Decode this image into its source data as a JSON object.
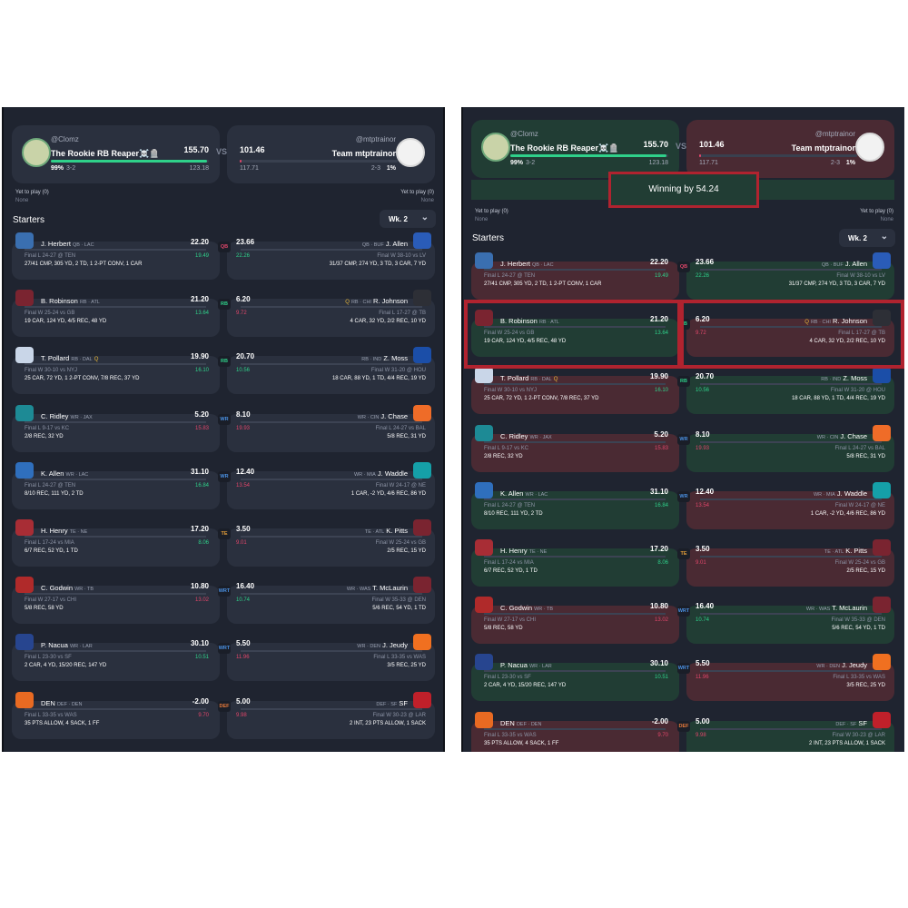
{
  "colors": {
    "win": "#213d34",
    "lose": "#4a2a33",
    "green": "#2fd18a",
    "red": "#e0466a",
    "highlight": "#b0232f"
  },
  "matchup": {
    "home": {
      "handle": "@Clomz",
      "name": "The Rookie RB Reaper☠️🪦",
      "score": "155.70",
      "projected": "123.18",
      "record": "3-2",
      "win_pct": "99%"
    },
    "away": {
      "handle": "@mtptrainor",
      "name": "Team mtptrainor",
      "score": "101.46",
      "projected": "117.71",
      "record": "2-3",
      "win_pct": "1%"
    },
    "vs": "VS",
    "yet_to_play_label": "Yet to play (0)",
    "yet_to_play_value": "None"
  },
  "starters_label": "Starters",
  "week_label": "Wk. 2",
  "winning_text": "Winning by 54.24",
  "rows": [
    {
      "pos": "QB",
      "l": {
        "name": "J. Herbert",
        "meta": "QB · LAC",
        "q": "",
        "pts": "22.20",
        "game": "Final L 24-27 @ TEN",
        "proj": "19.49",
        "stats": "27/41 CMP, 305 YD, 2 TD, 1 2-PT CONV, 1 CAR"
      },
      "r": {
        "name": "J. Allen",
        "meta": "QB · BUF",
        "q": "",
        "pts": "23.66",
        "game": "Final W 38-10 vs LV",
        "proj": "22.26",
        "stats": "31/37 CMP, 274 YD, 3 TD, 3 CAR, 7 YD"
      }
    },
    {
      "pos": "RB",
      "l": {
        "name": "B. Robinson",
        "meta": "RB · ATL",
        "q": "",
        "pts": "21.20",
        "game": "Final W 25-24 vs GB",
        "proj": "13.64",
        "stats": "19 CAR, 124 YD, 4/5 REC, 48 YD"
      },
      "r": {
        "name": "R. Johnson",
        "meta": "RB · CHI",
        "q": "Q",
        "pts": "6.20",
        "game": "Final L 17-27 @ TB",
        "proj": "9.72",
        "stats": "4 CAR, 32 YD, 2/2 REC, 10 YD"
      }
    },
    {
      "pos": "RB",
      "l": {
        "name": "T. Pollard",
        "meta": "RB · DAL",
        "q": "Q",
        "pts": "19.90",
        "game": "Final W 30-10 vs NYJ",
        "proj": "16.10",
        "stats": "25 CAR, 72 YD, 1 2-PT CONV, 7/8 REC, 37 YD"
      },
      "r": {
        "name": "Z. Moss",
        "meta": "RB · IND",
        "q": "",
        "pts": "20.70",
        "game": "Final W 31-20 @ HOU",
        "proj": "10.56",
        "stats": "18 CAR, 88 YD, 1 TD, 4/4 REC, 19 YD"
      }
    },
    {
      "pos": "WR",
      "l": {
        "name": "C. Ridley",
        "meta": "WR · JAX",
        "q": "",
        "pts": "5.20",
        "game": "Final L 9-17 vs KC",
        "proj": "15.83",
        "stats": "2/8 REC, 32 YD"
      },
      "r": {
        "name": "J. Chase",
        "meta": "WR · CIN",
        "q": "",
        "pts": "8.10",
        "game": "Final L 24-27 vs BAL",
        "proj": "19.93",
        "stats": "5/8 REC, 31 YD"
      }
    },
    {
      "pos": "WR",
      "l": {
        "name": "K. Allen",
        "meta": "WR · LAC",
        "q": "",
        "pts": "31.10",
        "game": "Final L 24-27 @ TEN",
        "proj": "16.84",
        "stats": "8/10 REC, 111 YD, 2 TD"
      },
      "r": {
        "name": "J. Waddle",
        "meta": "WR · MIA",
        "q": "",
        "pts": "12.40",
        "game": "Final W 24-17 @ NE",
        "proj": "13.54",
        "stats": "1 CAR, -2 YD, 4/6 REC, 86 YD"
      }
    },
    {
      "pos": "TE",
      "l": {
        "name": "H. Henry",
        "meta": "TE · NE",
        "q": "",
        "pts": "17.20",
        "game": "Final L 17-24 vs MIA",
        "proj": "8.06",
        "stats": "6/7 REC, 52 YD, 1 TD"
      },
      "r": {
        "name": "K. Pitts",
        "meta": "TE · ATL",
        "q": "",
        "pts": "3.50",
        "game": "Final W 25-24 vs GB",
        "proj": "9.01",
        "stats": "2/5 REC, 15 YD"
      }
    },
    {
      "pos": "WRT",
      "l": {
        "name": "C. Godwin",
        "meta": "WR · TB",
        "q": "",
        "pts": "10.80",
        "game": "Final W 27-17 vs CHI",
        "proj": "13.02",
        "stats": "5/8 REC, 58 YD"
      },
      "r": {
        "name": "T. McLaurin",
        "meta": "WR · WAS",
        "q": "",
        "pts": "16.40",
        "game": "Final W 35-33 @ DEN",
        "proj": "10.74",
        "stats": "5/6 REC, 54 YD, 1 TD"
      }
    },
    {
      "pos": "WRT",
      "l": {
        "name": "P. Nacua",
        "meta": "WR · LAR",
        "q": "",
        "pts": "30.10",
        "game": "Final L 23-30 vs SF",
        "proj": "10.51",
        "stats": "2 CAR, 4 YD, 15/20 REC, 147 YD"
      },
      "r": {
        "name": "J. Jeudy",
        "meta": "WR · DEN",
        "q": "",
        "pts": "5.50",
        "game": "Final L 33-35 vs WAS",
        "proj": "11.96",
        "stats": "3/5 REC, 25 YD"
      }
    },
    {
      "pos": "DEF",
      "l": {
        "name": "DEN",
        "meta": "DEF · DEN",
        "q": "",
        "pts": "-2.00",
        "game": "Final L 33-35 vs WAS",
        "proj": "9.70",
        "stats": "35 PTS ALLOW, 4 SACK, 1 FF"
      },
      "r": {
        "name": "SF",
        "meta": "DEF · SF",
        "q": "",
        "pts": "5.00",
        "game": "Final W 30-23 @ LAR",
        "proj": "9.98",
        "stats": "2 INT, 23 PTS ALLOW, 1 SACK"
      }
    }
  ]
}
